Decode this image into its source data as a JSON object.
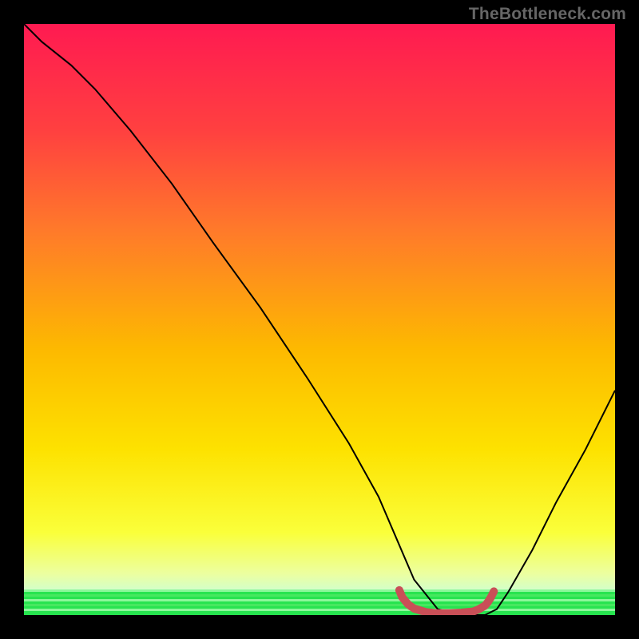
{
  "watermark": {
    "text": "TheBottleneck.com"
  },
  "chart_data": {
    "type": "line",
    "title": "",
    "xlabel": "",
    "ylabel": "",
    "xlim": [
      0,
      100
    ],
    "ylim": [
      0,
      100
    ],
    "background_gradient": {
      "top": "#ff1a51",
      "upper_mid": "#ff6a2b",
      "mid": "#fdd600",
      "lower_mid": "#faff3a",
      "bottom": "#27e44f"
    },
    "series": [
      {
        "name": "bottleneck-curve",
        "color": "#000000",
        "x": [
          0,
          3,
          8,
          12,
          18,
          25,
          32,
          40,
          48,
          55,
          60,
          63,
          66,
          70,
          74,
          78,
          80,
          82,
          86,
          90,
          95,
          100
        ],
        "y": [
          100,
          97,
          93,
          89,
          82,
          73,
          63,
          52,
          40,
          29,
          20,
          13,
          6,
          1,
          0,
          0,
          1,
          4,
          11,
          19,
          28,
          38
        ]
      },
      {
        "name": "optimal-zone-marker",
        "color": "#c94f57",
        "x": [
          63.5,
          64,
          65,
          66,
          68,
          70,
          72,
          74,
          76,
          77,
          78,
          78.5,
          79,
          79.5
        ],
        "y": [
          4.2,
          3.0,
          1.8,
          1.1,
          0.5,
          0.3,
          0.3,
          0.4,
          0.6,
          1.0,
          1.6,
          2.2,
          3.0,
          4.0
        ]
      }
    ],
    "green_band_y_fraction": 0.043
  }
}
